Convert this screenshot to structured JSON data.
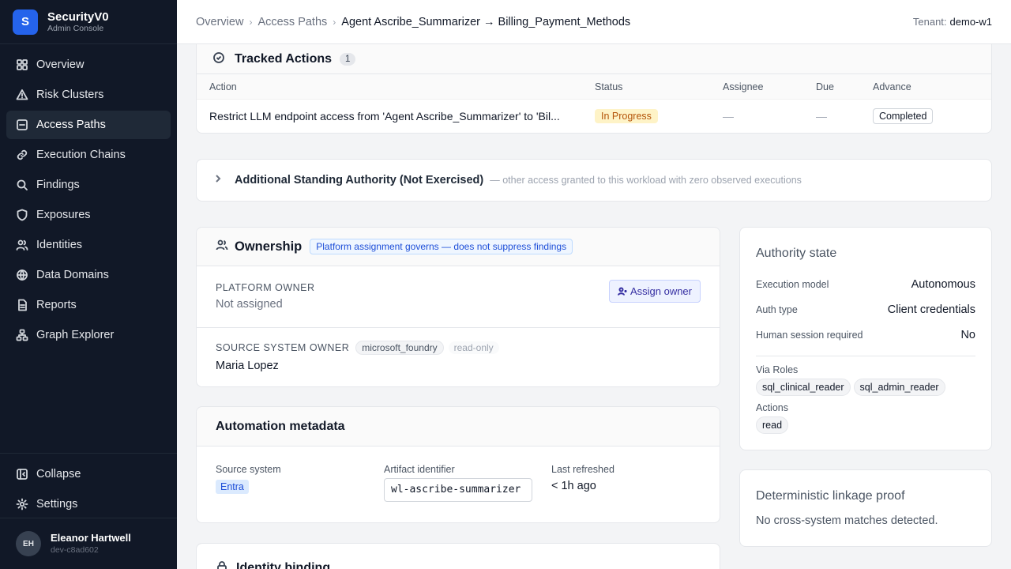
{
  "brand": {
    "logo_letter": "S",
    "name": "SecurityV0",
    "subtitle": "Admin Console"
  },
  "nav": {
    "items": [
      {
        "label": "Overview",
        "icon": "grid-icon"
      },
      {
        "label": "Risk Clusters",
        "icon": "warning-icon"
      },
      {
        "label": "Access Paths",
        "icon": "route-icon",
        "active": true
      },
      {
        "label": "Execution Chains",
        "icon": "link-icon"
      },
      {
        "label": "Findings",
        "icon": "search-icon"
      },
      {
        "label": "Exposures",
        "icon": "shield-icon"
      },
      {
        "label": "Identities",
        "icon": "users-icon"
      },
      {
        "label": "Data Domains",
        "icon": "globe-icon"
      },
      {
        "label": "Reports",
        "icon": "file-icon"
      },
      {
        "label": "Graph Explorer",
        "icon": "graph-icon"
      }
    ],
    "collapse": "Collapse",
    "settings": "Settings"
  },
  "user": {
    "initials": "EH",
    "name": "Eleanor Hartwell",
    "id": "dev-c8ad602"
  },
  "header": {
    "breadcrumbs": [
      "Overview",
      "Access Paths",
      "Agent Ascribe_Summarizer → Billing_Payment_Methods"
    ],
    "tenant_label": "Tenant:",
    "tenant_value": "demo-w1"
  },
  "tracked": {
    "title": "Tracked Actions",
    "count": "1",
    "columns": [
      "Action",
      "Status",
      "Assignee",
      "Due",
      "Advance"
    ],
    "rows": [
      {
        "action": "Restrict LLM endpoint access from 'Agent Ascribe_Summarizer' to 'Bil...",
        "status": "In Progress",
        "assignee": "—",
        "due": "—",
        "advance": "Completed"
      }
    ]
  },
  "additional": {
    "title": "Additional Standing Authority (Not Exercised)",
    "subtitle": "— other access granted to this workload with zero observed executions"
  },
  "ownership": {
    "title": "Ownership",
    "badge": "Platform assignment governs — does not suppress findings",
    "platform_owner_label": "PLATFORM OWNER",
    "platform_owner_value": "Not assigned",
    "assign_button": "Assign owner",
    "source_owner_label": "SOURCE SYSTEM OWNER",
    "source_chip": "microsoft_foundry",
    "source_readonly": "read-only",
    "source_owner_value": "Maria Lopez"
  },
  "automation": {
    "title": "Automation metadata",
    "source_label": "Source system",
    "source_value": "Entra",
    "artifact_label": "Artifact identifier",
    "artifact_value": "wl-ascribe-summarizer",
    "refreshed_label": "Last refreshed",
    "refreshed_value": "< 1h ago"
  },
  "binding": {
    "title": "Identity binding"
  },
  "authority": {
    "title": "Authority state",
    "rows": [
      {
        "key": "Execution model",
        "value": "Autonomous"
      },
      {
        "key": "Auth type",
        "value": "Client credentials"
      },
      {
        "key": "Human session required",
        "value": "No"
      }
    ],
    "roles_label": "Via Roles",
    "roles": [
      "sql_clinical_reader",
      "sql_admin_reader"
    ],
    "actions_label": "Actions",
    "actions": [
      "read"
    ]
  },
  "linkage": {
    "title": "Deterministic linkage proof",
    "value": "No cross-system matches detected."
  }
}
